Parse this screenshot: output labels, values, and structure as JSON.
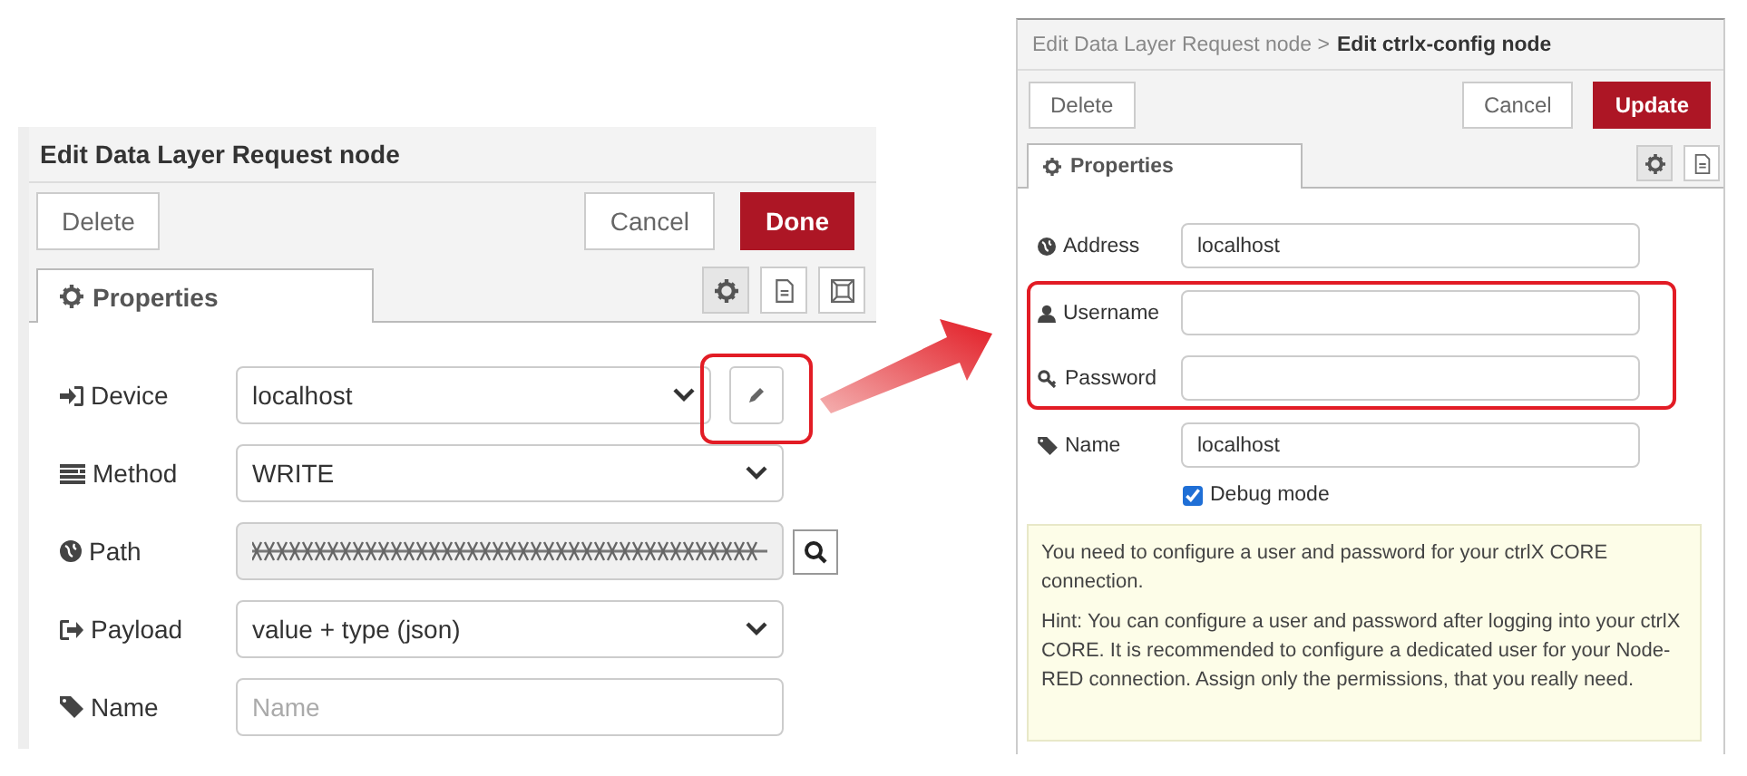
{
  "left_dialog": {
    "title": "Edit Data Layer Request node",
    "buttons": [
      {
        "label": "Delete",
        "kind": "plain"
      },
      {
        "label": "Cancel",
        "kind": "plain"
      },
      {
        "label": "Done",
        "kind": "primary"
      }
    ],
    "tabs": [
      {
        "label": "Properties",
        "selected": true
      }
    ],
    "tool_buttons": [
      {
        "kind": "settings",
        "selected": true
      },
      {
        "kind": "description",
        "selected": false
      },
      {
        "kind": "appearance",
        "selected": false
      }
    ],
    "fields": [
      {
        "label": "Device",
        "kind": "select",
        "value": "localhost",
        "edit_button": {
          "highlighted": true
        }
      },
      {
        "label": "Method",
        "kind": "select",
        "value": "WRITE"
      },
      {
        "label": "Path",
        "kind": "search",
        "obscured": true
      },
      {
        "label": "Payload",
        "kind": "select",
        "value": "value + type (json)"
      },
      {
        "label": "Name",
        "kind": "input",
        "placeholder": "Name"
      }
    ]
  },
  "right_dialog": {
    "breadcrumb": "Edit Data Layer Request node >",
    "title": "Edit ctrlx-config node",
    "buttons": [
      {
        "label": "Delete",
        "kind": "plain"
      },
      {
        "label": "Cancel",
        "kind": "plain"
      },
      {
        "label": "Update",
        "kind": "primary"
      }
    ],
    "tabs": [
      {
        "label": "Properties",
        "selected": true
      }
    ],
    "tool_buttons": [
      {
        "kind": "settings",
        "selected": true
      },
      {
        "kind": "description",
        "selected": false
      }
    ],
    "fields": [
      {
        "label": "Address",
        "value": "localhost",
        "highlighted": false
      },
      {
        "label": "Username",
        "highlighted": true
      },
      {
        "label": "Password",
        "highlighted": true
      },
      {
        "label": "Name",
        "value": "localhost",
        "highlighted": false
      }
    ],
    "debug_mode": {
      "label": "Debug mode",
      "checked": true
    },
    "hint": [
      "You need to configure a user and password for your ctrlX CORE connection.",
      "Hint: You can configure a user and password after logging into your ctrlX CORE. It is recommended to configure a dedicated user for your Node-RED connection. Assign only the permissions, that you really need."
    ]
  }
}
